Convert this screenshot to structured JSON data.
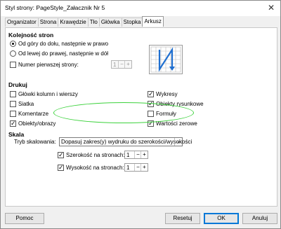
{
  "window": {
    "title": "Styl strony: PageStyle_Załacznik Nr 5",
    "close_glyph": "✕"
  },
  "tabs": [
    {
      "label": "Organizator",
      "active": false
    },
    {
      "label": "Strona",
      "active": false
    },
    {
      "label": "Krawędzie",
      "active": false
    },
    {
      "label": "Tło",
      "active": false
    },
    {
      "label": "Główka",
      "active": false
    },
    {
      "label": "Stopka",
      "active": false
    },
    {
      "label": "Arkusz",
      "active": true
    }
  ],
  "page_order": {
    "title": "Kolejność stron",
    "option_top_down": "Od góry do dołu, następnie w prawo",
    "option_left_right": "Od lewej do prawej, następnie w dół",
    "first_page_label": "Numer pierwszej strony:",
    "first_page_value": "1"
  },
  "print": {
    "title": "Drukuj",
    "col_row_headers": "Główki kolumn i wierszy",
    "grid": "Siatka",
    "comments": "Komentarze",
    "objects_images": "Obiekty/obrazy",
    "charts": "Wykresy",
    "drawing_objects": "Obiekty rysunkowe",
    "formulas": "Formuły",
    "zero_values": "Wartości zerowe"
  },
  "scale": {
    "title": "Skala",
    "mode_label": "Tryb skalowania:",
    "mode_value": "Dopasuj zakres(y) wydruku do szerokości/wysokości",
    "width_label": "Szerokość na stronach:",
    "width_value": "1",
    "height_label": "Wysokość na stronach:",
    "height_value": "1"
  },
  "buttons": {
    "help": "Pomoc",
    "reset": "Resetuj",
    "ok": "OK",
    "cancel": "Anuluj"
  },
  "colors": {
    "annotation_oval": "#3cd23c",
    "preview_arrow": "#1f6fd0",
    "default_button_border": "#0078d7"
  }
}
